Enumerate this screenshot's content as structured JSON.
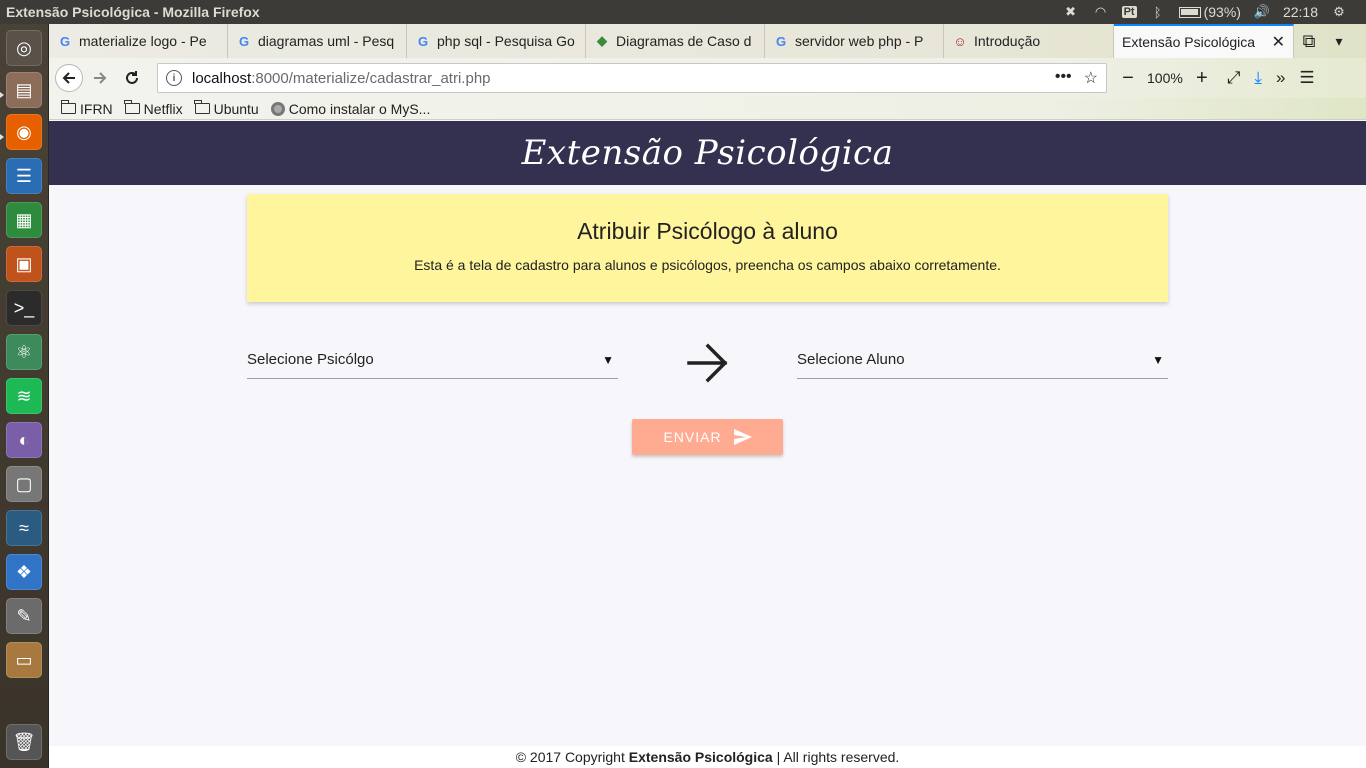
{
  "window": {
    "title": "Extensão Psicológica - Mozilla Firefox"
  },
  "system": {
    "battery_text": "(93%)",
    "clock": "22:18",
    "pt_label": "Pt"
  },
  "launcher": {
    "items": [
      "ubuntu-dash-icon",
      "files-icon",
      "firefox-icon",
      "writer-icon",
      "calc-icon",
      "impress-icon",
      "terminal-icon",
      "atom-icon",
      "spotify-icon",
      "color-icon",
      "camera-icon",
      "mysql-workbench-icon",
      "dropbox-icon",
      "text-editor-icon",
      "archive-icon",
      "trash-icon"
    ]
  },
  "tabs": [
    {
      "label": "materialize logo - Pe",
      "favicon": "G"
    },
    {
      "label": "diagramas uml - Pesq",
      "favicon": "G"
    },
    {
      "label": "php sql - Pesquisa Go",
      "favicon": "G"
    },
    {
      "label": "Diagramas de Caso d",
      "favicon": "◆"
    },
    {
      "label": "servidor web php - P",
      "favicon": "G"
    },
    {
      "label": "Introdução",
      "favicon": "☺"
    },
    {
      "label": "Extensão Psicológica",
      "favicon": ""
    }
  ],
  "navbar": {
    "url_host": "localhost",
    "url_path": ":8000/materialize/cadastrar_atri.php",
    "zoom": "100%"
  },
  "bookmarks": [
    {
      "label": "IFRN",
      "icon": "folder-icon"
    },
    {
      "label": "Netflix",
      "icon": "folder-icon"
    },
    {
      "label": "Ubuntu",
      "icon": "folder-icon"
    },
    {
      "label": "Como instalar o MyS...",
      "icon": "globe-icon"
    }
  ],
  "site": {
    "brand": "Extensão Psicológica",
    "banner_title": "Atribuir Psicólogo à aluno",
    "banner_text": "Esta é a tela de cadastro para alunos e psicólogos, preencha os campos abaixo corretamente.",
    "select_psicologo": "Selecione Psicólgo",
    "select_aluno": "Selecione Aluno",
    "send_label": "ENVIAR",
    "footer_prefix": "© 2017 Copyright ",
    "footer_brand": "Extensão Psicológica",
    "footer_suffix": " | All rights reserved."
  },
  "colors": {
    "header_bg": "#33314f",
    "banner_bg": "#fff59d",
    "button_bg": "#ffab91",
    "firefox_accent": "#0a84ff"
  }
}
